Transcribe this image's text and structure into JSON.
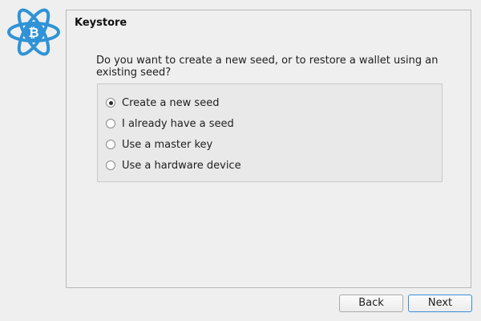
{
  "panel": {
    "title": "Keystore",
    "question": "Do you want to create a new seed, or to restore a wallet using an existing seed?"
  },
  "options": [
    {
      "label": "Create a new seed",
      "checked": true
    },
    {
      "label": "I already have a seed",
      "checked": false
    },
    {
      "label": "Use a master key",
      "checked": false
    },
    {
      "label": "Use a hardware device",
      "checked": false
    }
  ],
  "buttons": {
    "back_label": "Back",
    "next_label": "Next"
  },
  "colors": {
    "logo_blue": "#2f93d6",
    "focus_border": "#3a8cd6"
  },
  "icons": {
    "logo": "electrum-bitcoin-atom-logo"
  }
}
